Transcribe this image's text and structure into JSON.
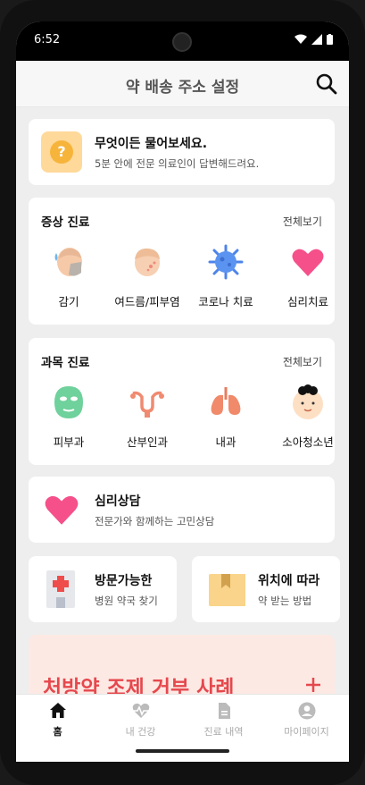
{
  "status": {
    "time": "6:52"
  },
  "appbar": {
    "title": "약 배송 주소 설정"
  },
  "ask": {
    "title": "무엇이든 물어보세요.",
    "subtitle": "5분 안에 전문 의료인이 답변해드려요.",
    "icon_text": "?"
  },
  "symptom_section": {
    "title": "증상 진료",
    "more": "전체보기",
    "items": [
      {
        "label": "감기",
        "icon": "cold-face-icon"
      },
      {
        "label": "여드름/피부염",
        "icon": "acne-face-icon"
      },
      {
        "label": "코로나 치료",
        "icon": "virus-icon"
      },
      {
        "label": "심리치료",
        "icon": "heart-icon"
      }
    ]
  },
  "department_section": {
    "title": "과목 진료",
    "more": "전체보기",
    "items": [
      {
        "label": "피부과",
        "icon": "face-mask-icon"
      },
      {
        "label": "산부인과",
        "icon": "uterus-icon"
      },
      {
        "label": "내과",
        "icon": "lungs-icon"
      },
      {
        "label": "소아청소년",
        "icon": "child-face-icon"
      }
    ]
  },
  "consult": {
    "title": "심리상담",
    "subtitle": "전문가와 함께하는 고민상담"
  },
  "hospital_card": {
    "title": "방문가능한",
    "subtitle": "병원 약국 찾기"
  },
  "delivery_card": {
    "title": "위치에 따라",
    "subtitle": "약 받는 방법"
  },
  "banner": {
    "text": "처방약 조제 거부 사례"
  },
  "bottom_nav": {
    "items": [
      {
        "label": "홈",
        "icon": "home-icon",
        "active": true
      },
      {
        "label": "내 건강",
        "icon": "heartbeat-icon",
        "active": false
      },
      {
        "label": "진료 내역",
        "icon": "document-icon",
        "active": false
      },
      {
        "label": "마이페이지",
        "icon": "account-icon",
        "active": false
      }
    ]
  },
  "colors": {
    "accent_red": "#e5484d",
    "heart_pink": "#f5508a",
    "banner_bg": "#fde9e4",
    "ask_icon_bg": "#ffd99a"
  }
}
